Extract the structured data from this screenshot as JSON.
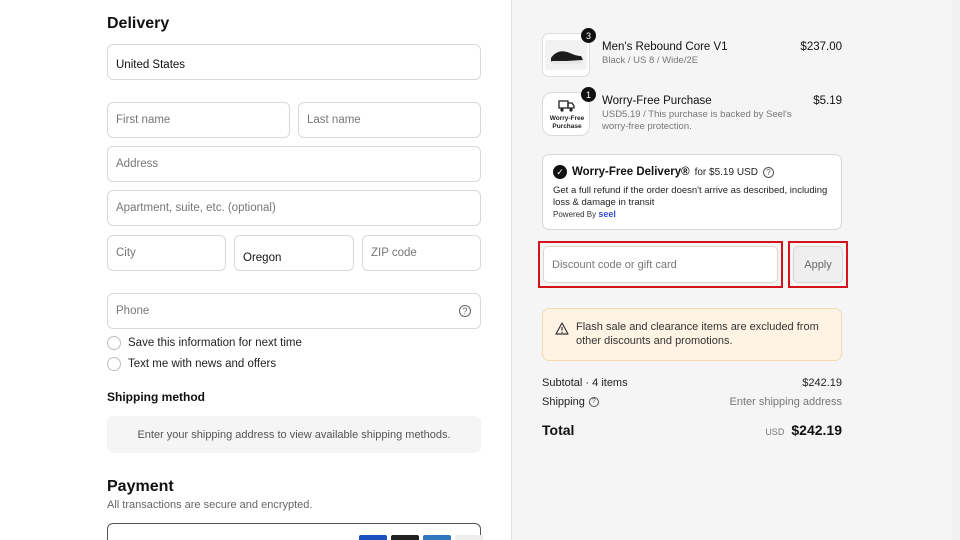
{
  "delivery": {
    "heading": "Delivery",
    "country": "United States",
    "first_name_placeholder": "First name",
    "last_name_placeholder": "Last name",
    "address_placeholder": "Address",
    "apartment_placeholder": "Apartment, suite, etc. (optional)",
    "city_placeholder": "City",
    "state": "Oregon",
    "zip_placeholder": "ZIP code",
    "phone_placeholder": "Phone",
    "save_info_label": "Save this information for next time",
    "text_me_label": "Text me with news and offers"
  },
  "shipping_method": {
    "heading": "Shipping method",
    "info": "Enter your shipping address to view available shipping methods."
  },
  "payment": {
    "heading": "Payment",
    "subtitle": "All transactions are secure and encrypted."
  },
  "order": {
    "items": [
      {
        "name": "Men's Rebound Core V1",
        "variant": "Black / US 8 / Wide/2E",
        "price": "$237.00",
        "qty": "3"
      },
      {
        "name": "Worry-Free Purchase",
        "variant": "USD5.19 / This purchase is backed by Seel's worry-free protection.",
        "price": "$5.19",
        "qty": "1",
        "thumb_text": "Worry-Free Purchase"
      }
    ],
    "seel": {
      "title": "Worry-Free Delivery®",
      "price_text": "for $5.19 USD",
      "description": "Get a full refund if the order doesn't arrive as described, including loss & damage in transit",
      "powered_by": "Powered By",
      "brand": "seel"
    },
    "discount_placeholder": "Discount code or gift card",
    "apply_label": "Apply",
    "notice": "Flash sale and clearance items are excluded from other discounts and promotions.",
    "subtotal_label": "Subtotal · 4 items",
    "subtotal_value": "$242.19",
    "shipping_label": "Shipping",
    "shipping_value": "Enter shipping address",
    "total_label": "Total",
    "total_currency": "USD",
    "total_value": "$242.19"
  },
  "colors": {
    "highlight": "#d4141c",
    "notice_bg": "#fff3e3",
    "seel_brand": "#3a4fd8"
  }
}
